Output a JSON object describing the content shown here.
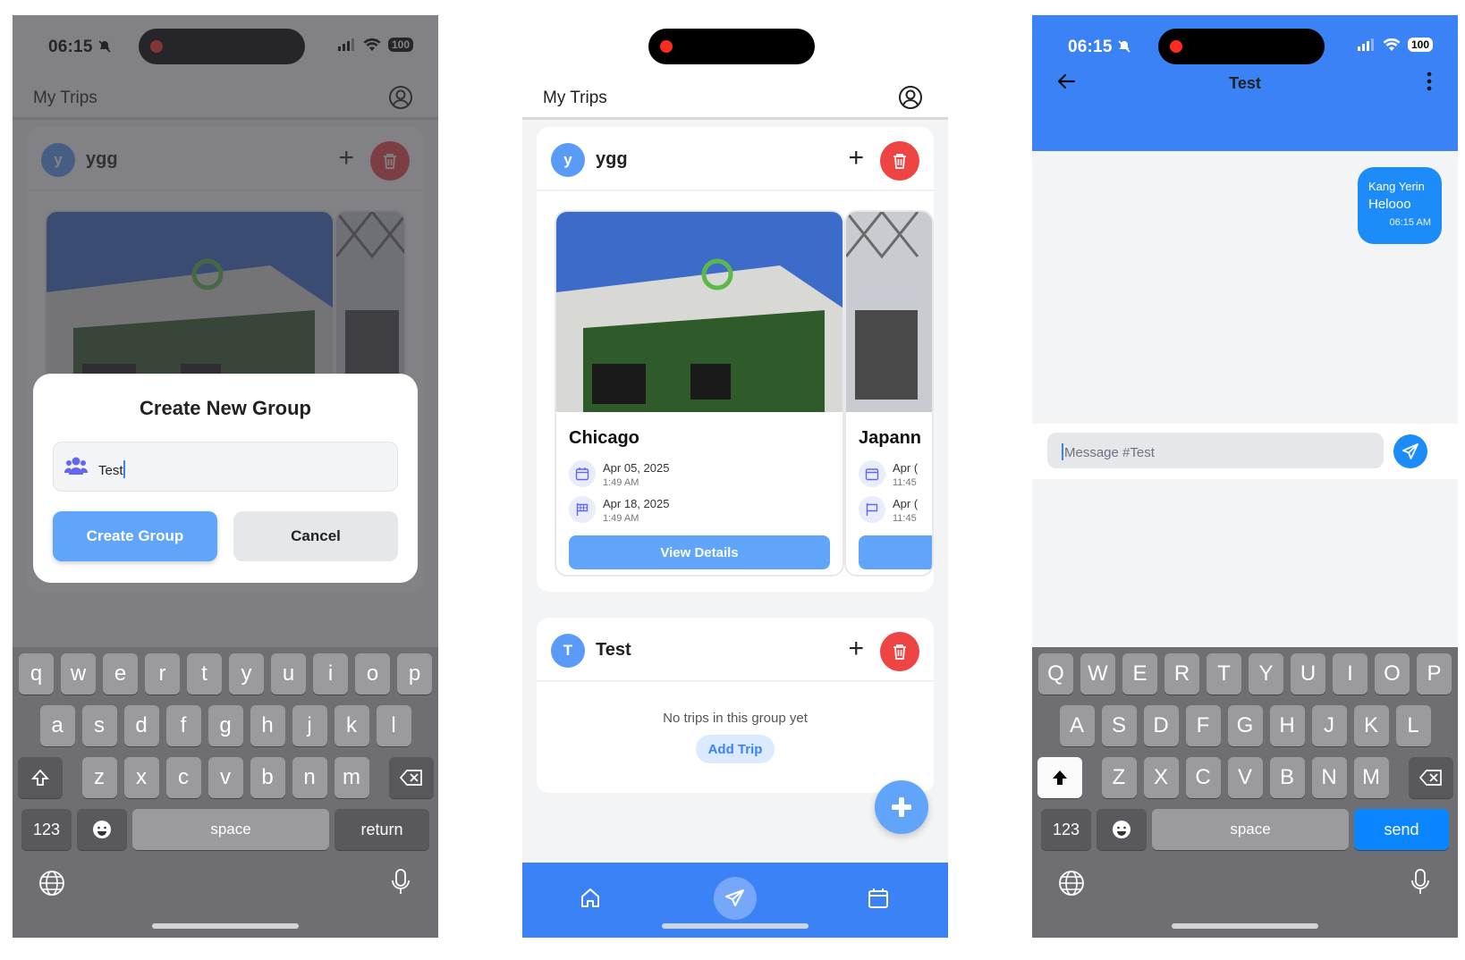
{
  "status": {
    "time": "06:15",
    "battery": "100"
  },
  "app": {
    "title": "My Trips"
  },
  "groups": [
    {
      "initial": "y",
      "name": "ygg",
      "add_symbol": "+"
    },
    {
      "initial": "T",
      "name": "Test",
      "add_symbol": "+",
      "empty_text": "No trips in this group yet",
      "add_trip_label": "Add Trip"
    }
  ],
  "trips": [
    {
      "name": "Chicago",
      "start_date": "Apr 05, 2025",
      "start_time": "1:49 AM",
      "end_date": "Apr 18, 2025",
      "end_time": "1:49 AM",
      "button": "View Details"
    },
    {
      "name": "Japann",
      "start_date": "Apr (",
      "start_time": "11:45",
      "end_date": "Apr (",
      "end_time": "11:45"
    }
  ],
  "modal": {
    "title": "Create New Group",
    "input_value": "Test",
    "create_label": "Create Group",
    "cancel_label": "Cancel"
  },
  "keyboard_lower": {
    "row1": [
      "q",
      "w",
      "e",
      "r",
      "t",
      "y",
      "u",
      "i",
      "o",
      "p"
    ],
    "row2": [
      "a",
      "s",
      "d",
      "f",
      "g",
      "h",
      "j",
      "k",
      "l"
    ],
    "row3": [
      "z",
      "x",
      "c",
      "v",
      "b",
      "n",
      "m"
    ],
    "numbers": "123",
    "space": "space",
    "action": "return"
  },
  "keyboard_upper": {
    "row1": [
      "Q",
      "W",
      "E",
      "R",
      "T",
      "Y",
      "U",
      "I",
      "O",
      "P"
    ],
    "row2": [
      "A",
      "S",
      "D",
      "F",
      "G",
      "H",
      "J",
      "K",
      "L"
    ],
    "row3": [
      "Z",
      "X",
      "C",
      "V",
      "B",
      "N",
      "M"
    ],
    "numbers": "123",
    "space": "space",
    "action": "send"
  },
  "chat": {
    "title": "Test",
    "message": {
      "sender": "Kang Yerin",
      "text": "Helooo",
      "time": "06:15 AM"
    },
    "placeholder": "Message #Test"
  },
  "colors": {
    "accent": "#3b82f6",
    "button": "#60a5fa",
    "danger": "#ef4444"
  },
  "icons": [
    "bell-slash-icon",
    "signal-icon",
    "wifi-icon",
    "account-circle-icon",
    "trash-icon",
    "users-icon",
    "calendar-icon",
    "flag-icon",
    "plus-icon",
    "home-icon",
    "plane-icon",
    "back-arrow-icon",
    "more-vert-icon",
    "send-icon",
    "globe-icon",
    "mic-icon",
    "shift-icon",
    "backspace-icon",
    "emoji-icon"
  ]
}
